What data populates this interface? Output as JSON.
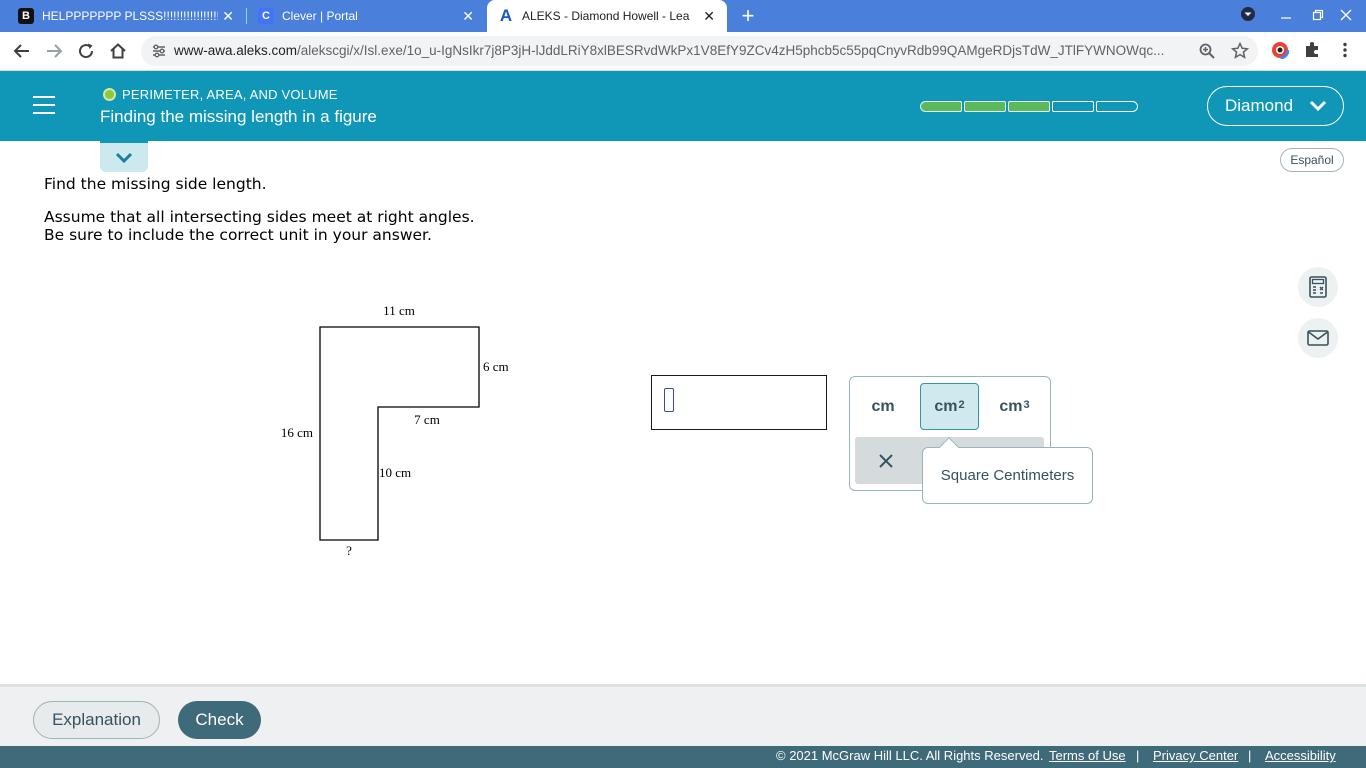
{
  "browser": {
    "tabs": [
      {
        "title": "HELPPPPPPP PLSSS!!!!!!!!!!!!!!!!!",
        "favicon": "B",
        "favicon_color": "#111111",
        "active": false
      },
      {
        "title": "Clever | Portal",
        "favicon": "C",
        "favicon_color": "#4274f6",
        "active": false
      },
      {
        "title": "ALEKS - Diamond Howell - Learn",
        "favicon": "A",
        "favicon_color": "#1a56c4",
        "active": true
      }
    ],
    "url_host": "www-awa.aleks.com",
    "url_path": "/alekscgi/x/Isl.exe/1o_u-IgNsIkr7j8P3jH-lJddLRiY8xlBESRvdWkPx1V8EfY9ZCv4zH5phcb5c55pqCnyvRdb99QAMgeRDjsTdW_JTlFYWNOWqc..."
  },
  "header": {
    "topic": "PERIMETER, AREA, AND VOLUME",
    "lesson": "Finding the missing length in a figure",
    "progress": {
      "completed": 3,
      "total": 5
    },
    "user_name": "Diamond",
    "colors": {
      "header_bg": "#1097b8",
      "progress_done": "#5cb85c",
      "topic_dot": "#8dc63f"
    }
  },
  "language_button": "Español",
  "problem": {
    "line1": "Find the missing side length.",
    "line2": "Assume that all intersecting sides meet at right angles.",
    "line3": "Be sure to include the correct unit in your answer."
  },
  "figure": {
    "labels": {
      "top": "11  cm",
      "right_upper": "6  cm",
      "inner_horizontal": "7  cm",
      "left": "16  cm",
      "inner_vertical": "10  cm",
      "bottom": "?"
    }
  },
  "answer": {
    "value": "",
    "units": [
      {
        "base": "cm",
        "exp": ""
      },
      {
        "base": "cm",
        "exp": "2"
      },
      {
        "base": "cm",
        "exp": "3"
      }
    ],
    "hovered_unit": 1,
    "tooltip": "Square Centimeters"
  },
  "tools": [
    "calculator-icon",
    "mail-icon"
  ],
  "footer": {
    "explanation": "Explanation",
    "check": "Check",
    "copyright": "© 2021 McGraw Hill LLC. All Rights Reserved.",
    "terms": "Terms of Use",
    "privacy": "Privacy Center",
    "accessibility": "Accessibility",
    "separator": "|"
  }
}
